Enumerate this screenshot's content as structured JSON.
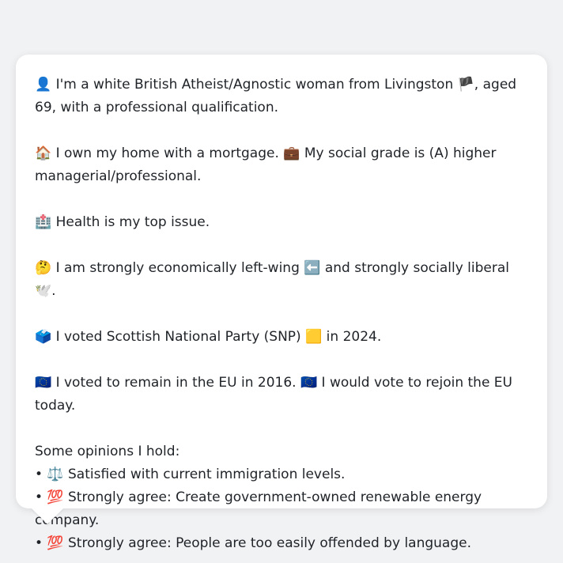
{
  "profile": {
    "line1": "👤 I'm a white British Atheist/Agnostic woman from Livingston 🏴, aged 69, with a professional qualification.",
    "line2": "🏠 I own my home with a mortgage. 💼 My social grade is (A) higher managerial/professional.",
    "line3": "🏥 Health is my top issue.",
    "line4": "🤔 I am strongly economically left-wing ⬅️ and strongly socially liberal 🕊️.",
    "line5": "🗳️ I voted Scottish National Party (SNP) 🟨 in 2024.",
    "line6": "🇪🇺 I voted to remain in the EU in 2016. 🇪🇺 I would vote to rejoin the EU today."
  },
  "opinions": {
    "heading": "Some opinions I hold:",
    "items": [
      "• ⚖️ Satisfied with current immigration levels.",
      "• 💯 Strongly agree: Create government-owned renewable energy company.",
      "• 💯 Strongly agree: People are too easily offended by language."
    ]
  }
}
